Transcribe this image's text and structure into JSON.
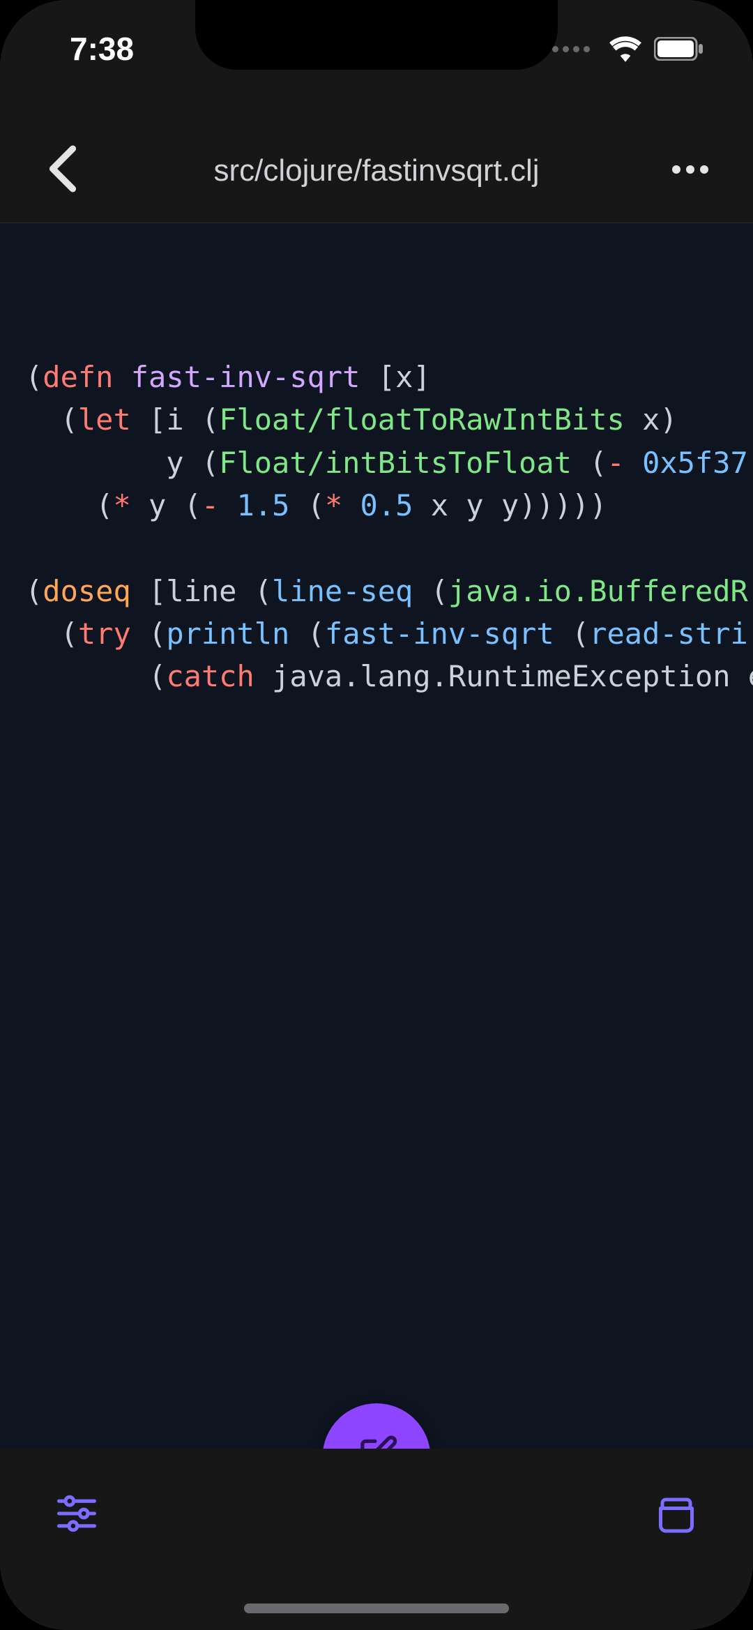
{
  "status": {
    "time": "7:38"
  },
  "header": {
    "file_path": "src/clojure/fastinvsqrt.clj"
  },
  "code": {
    "lines": [
      {
        "indent": 0,
        "tokens": [
          {
            "t": "(",
            "c": "p"
          },
          {
            "t": "defn",
            "c": "kw"
          },
          {
            "t": " ",
            "c": "p"
          },
          {
            "t": "fast-inv-sqrt",
            "c": "fn"
          },
          {
            "t": " [",
            "c": "p"
          },
          {
            "t": "x",
            "c": "var"
          },
          {
            "t": "]",
            "c": "p"
          }
        ]
      },
      {
        "indent": 2,
        "tokens": [
          {
            "t": "(",
            "c": "p"
          },
          {
            "t": "let",
            "c": "kw"
          },
          {
            "t": " [",
            "c": "p"
          },
          {
            "t": "i",
            "c": "var"
          },
          {
            "t": " (",
            "c": "p"
          },
          {
            "t": "Float/floatToRawIntBits",
            "c": "cls"
          },
          {
            "t": " ",
            "c": "p"
          },
          {
            "t": "x",
            "c": "var"
          },
          {
            "t": ")",
            "c": "p"
          }
        ]
      },
      {
        "indent": 8,
        "tokens": [
          {
            "t": "y",
            "c": "var"
          },
          {
            "t": " (",
            "c": "p"
          },
          {
            "t": "Float/intBitsToFloat",
            "c": "cls"
          },
          {
            "t": " (",
            "c": "p"
          },
          {
            "t": "-",
            "c": "op"
          },
          {
            "t": " ",
            "c": "p"
          },
          {
            "t": "0x5f37",
            "c": "num"
          }
        ]
      },
      {
        "indent": 4,
        "tokens": [
          {
            "t": "(",
            "c": "p"
          },
          {
            "t": "*",
            "c": "op"
          },
          {
            "t": " ",
            "c": "p"
          },
          {
            "t": "y",
            "c": "var"
          },
          {
            "t": " (",
            "c": "p"
          },
          {
            "t": "-",
            "c": "op"
          },
          {
            "t": " ",
            "c": "p"
          },
          {
            "t": "1.5",
            "c": "num"
          },
          {
            "t": " (",
            "c": "p"
          },
          {
            "t": "*",
            "c": "op"
          },
          {
            "t": " ",
            "c": "p"
          },
          {
            "t": "0.5",
            "c": "num"
          },
          {
            "t": " ",
            "c": "p"
          },
          {
            "t": "x",
            "c": "var"
          },
          {
            "t": " ",
            "c": "p"
          },
          {
            "t": "y",
            "c": "var"
          },
          {
            "t": " ",
            "c": "p"
          },
          {
            "t": "y",
            "c": "var"
          },
          {
            "t": ")))))",
            "c": "p"
          }
        ]
      },
      {
        "blank": true
      },
      {
        "indent": 0,
        "tokens": [
          {
            "t": "(",
            "c": "p"
          },
          {
            "t": "doseq",
            "c": "kw2"
          },
          {
            "t": " [",
            "c": "p"
          },
          {
            "t": "line",
            "c": "var"
          },
          {
            "t": " (",
            "c": "p"
          },
          {
            "t": "line-seq",
            "c": "call"
          },
          {
            "t": " (",
            "c": "p"
          },
          {
            "t": "java.io.BufferedR",
            "c": "cls"
          }
        ]
      },
      {
        "indent": 2,
        "tokens": [
          {
            "t": "(",
            "c": "p"
          },
          {
            "t": "try",
            "c": "kw"
          },
          {
            "t": " (",
            "c": "p"
          },
          {
            "t": "println",
            "c": "call"
          },
          {
            "t": " (",
            "c": "p"
          },
          {
            "t": "fast-inv-sqrt",
            "c": "call"
          },
          {
            "t": " (",
            "c": "p"
          },
          {
            "t": "read-stri",
            "c": "call"
          }
        ]
      },
      {
        "indent": 7,
        "tokens": [
          {
            "t": "(",
            "c": "p"
          },
          {
            "t": "catch",
            "c": "kw"
          },
          {
            "t": " ",
            "c": "p"
          },
          {
            "t": "java.lang.RuntimeException",
            "c": "var"
          },
          {
            "t": " ",
            "c": "p"
          },
          {
            "t": "e",
            "c": "var"
          }
        ]
      }
    ]
  },
  "colors": {
    "accent": "#8e45ff",
    "icon_accent": "#7c6cff"
  }
}
